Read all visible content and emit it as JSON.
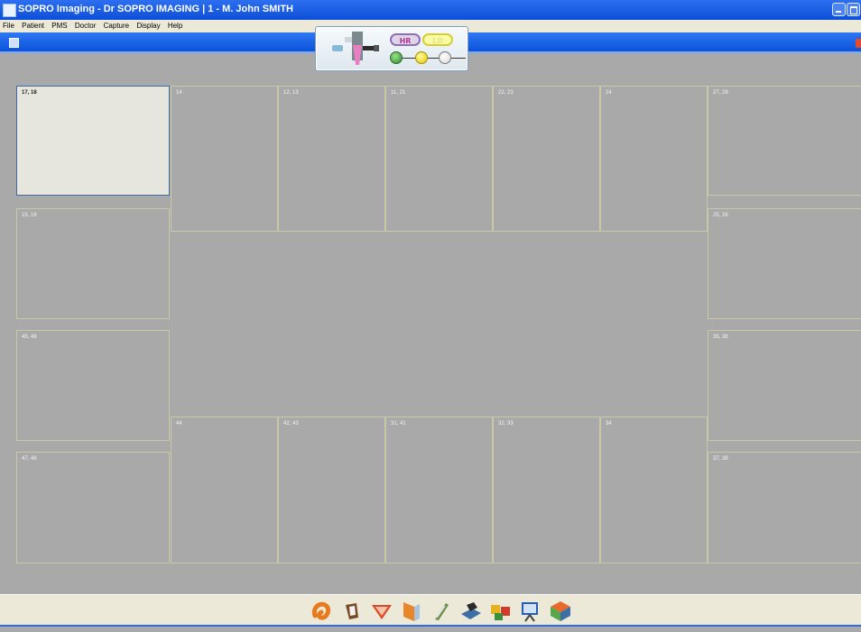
{
  "window": {
    "title": "SOPRO Imaging - Dr SOPRO IMAGING | 1 - M. John SMITH"
  },
  "menu": [
    "File",
    "Patient",
    "PMS",
    "Doctor",
    "Capture",
    "Display",
    "Help"
  ],
  "device_panel": {
    "pill_left": "HR",
    "pill_right": "LD",
    "leds": [
      "green",
      "yellow",
      "white"
    ]
  },
  "tiles": [
    {
      "label": "17, 18",
      "selected": true
    },
    {
      "label": "14"
    },
    {
      "label": "12, 13"
    },
    {
      "label": "11, 21"
    },
    {
      "label": "22, 23"
    },
    {
      "label": "24"
    },
    {
      "label": "27, 28"
    },
    {
      "label": "15, 16"
    },
    {
      "label": "25, 26"
    },
    {
      "label": "45, 46"
    },
    {
      "label": "35, 36"
    },
    {
      "label": "44"
    },
    {
      "label": "42, 43"
    },
    {
      "label": "31, 41"
    },
    {
      "label": "32, 33"
    },
    {
      "label": "34"
    },
    {
      "label": "47, 48"
    },
    {
      "label": "37, 38"
    }
  ],
  "toolbar": {
    "tools": [
      {
        "name": "panoramic",
        "color": "#e87a1e"
      },
      {
        "name": "intraoral-sensor",
        "color": "#7a4b23"
      },
      {
        "name": "intraoral-camera",
        "color": "#d84a2a"
      },
      {
        "name": "periapical",
        "color": "#e8862a"
      },
      {
        "name": "endo",
        "color": "#6d8f4b"
      },
      {
        "name": "scanner",
        "color": "#3d6fa6"
      },
      {
        "name": "comparison",
        "color": "#d23a2a"
      },
      {
        "name": "presentation",
        "color": "#2a5fb0"
      },
      {
        "name": "3d-view",
        "color": "#58a54a"
      }
    ]
  },
  "colors": {
    "titlebar": "#0c4fd8",
    "workspace": "#a9a9a9",
    "selected_tile": "#e6e5de"
  }
}
